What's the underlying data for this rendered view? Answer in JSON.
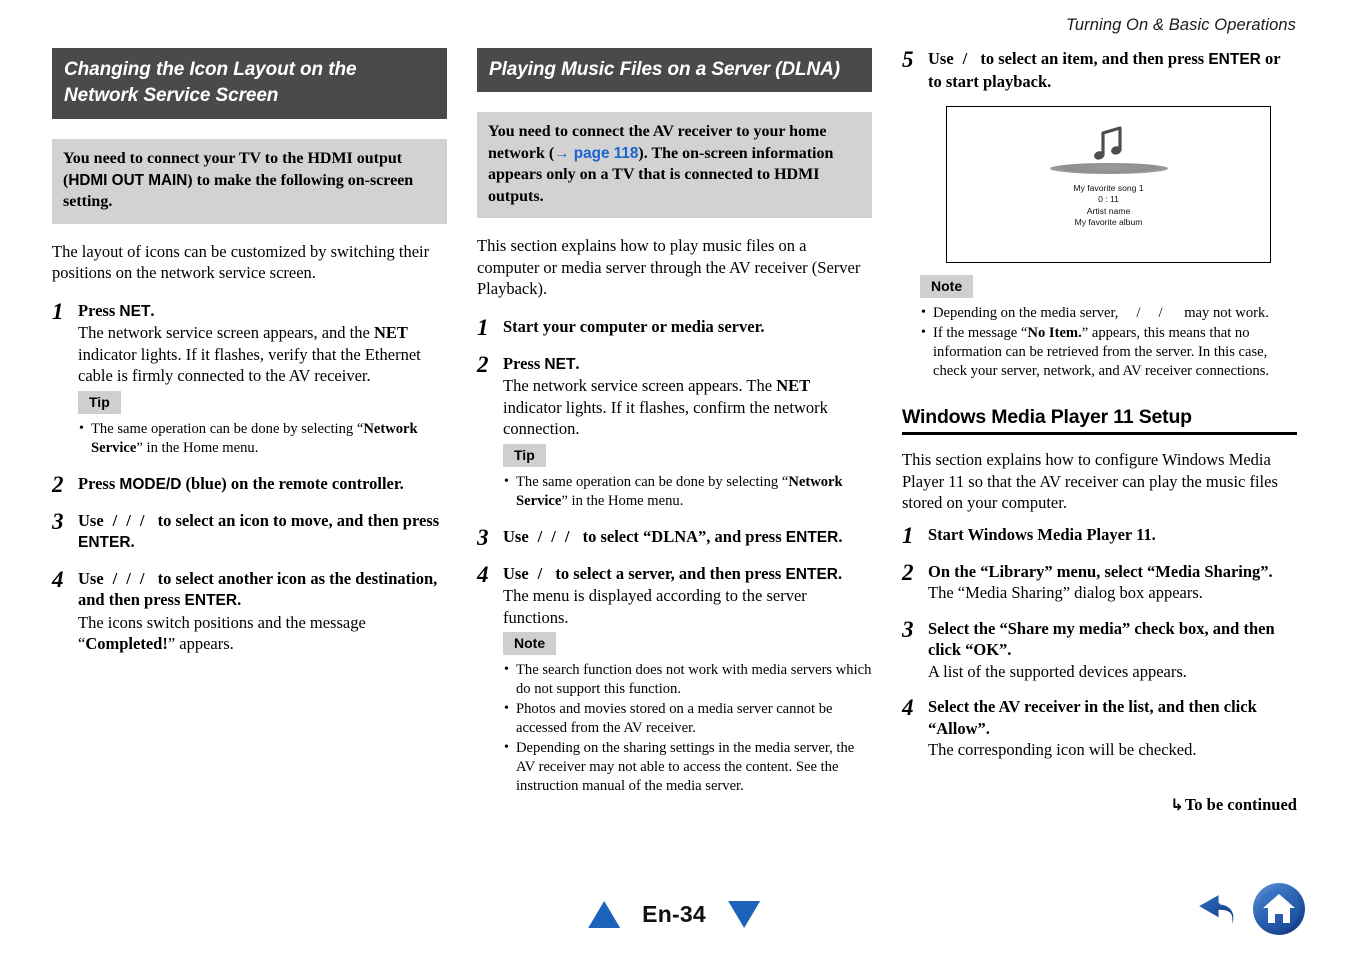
{
  "header": {
    "running_title": "Turning On & Basic Operations"
  },
  "left_column": {
    "section_title": "Changing the Icon Layout on the Network Service Screen",
    "callout": {
      "part1": "You need to connect your TV to the HDMI output (",
      "emphasis": "HDMI OUT MAIN",
      "part2": ") to make the following on-screen setting."
    },
    "intro": "The layout of icons can be customized by switching their positions on the network service screen.",
    "steps": [
      {
        "num": "1",
        "title_pre": "Press ",
        "title_key": "NET",
        "title_post": ".",
        "desc_a": "The network service screen appears, and the ",
        "desc_key": "NET",
        "desc_b": " indicator lights. If it flashes, verify that the Ethernet cable is firmly connected to the AV receiver."
      },
      {
        "num": "2",
        "title_pre": "Press ",
        "title_key": "MODE/D",
        "title_post": " (blue) on the remote controller."
      },
      {
        "num": "3",
        "title_use": "Use",
        "title_mid": "to select an icon to move, and then press ",
        "title_key": "ENTER",
        "title_post": "."
      },
      {
        "num": "4",
        "title_use": "Use",
        "title_mid": "to select another icon as the destination, and then press ",
        "title_key": "ENTER",
        "title_post": ".",
        "desc_a": "The icons switch positions and the message “",
        "desc_bold": "Completed!",
        "desc_b": "” appears."
      }
    ],
    "tip": {
      "badge": "Tip",
      "items_pre": "The same operation can be done by selecting “",
      "items_bold": "Network Service",
      "items_post": "” in the Home menu."
    }
  },
  "middle_column": {
    "section_title": "Playing Music Files on a Server (DLNA)",
    "callout": {
      "part1": "You need to connect the AV receiver to your home network (",
      "link_arrow": "→",
      "link_text": "page 118",
      "part2": "). The on-screen information appears only on a TV that is connected to HDMI outputs."
    },
    "intro": "This section explains how to play music files on a computer or media server through the AV receiver (Server Playback).",
    "steps": [
      {
        "num": "1",
        "title": "Start your computer or media server."
      },
      {
        "num": "2",
        "title_pre": "Press ",
        "title_key": "NET",
        "title_post": ".",
        "desc_a": "The network service screen appears. The ",
        "desc_key": "NET",
        "desc_b": " indicator lights. If it flashes, confirm the network connection."
      },
      {
        "num": "3",
        "title_use": "Use",
        "title_mid": "to select “DLNA”, and press ",
        "title_key": "ENTER",
        "title_post": "."
      },
      {
        "num": "4",
        "title_use": "Use",
        "title_mid": "to select a server, and then press ",
        "title_key": "ENTER",
        "title_post": ".",
        "desc": "The menu is displayed according to the server functions."
      }
    ],
    "tip": {
      "badge": "Tip",
      "items_pre": "The same operation can be done by selecting “",
      "items_bold": "Network Service",
      "items_post": "” in the Home menu."
    },
    "note": {
      "badge": "Note",
      "items": [
        "The search function does not work with media servers which do not support this function.",
        "Photos and movies stored on a media server cannot be accessed from the AV receiver.",
        "Depending on the sharing settings in the media server, the AV receiver may not able to access the content. See the instruction manual of the media server."
      ]
    }
  },
  "right_column": {
    "step5": {
      "num": "5",
      "title_use": "Use",
      "title_mid": "to select an item, and then press ",
      "title_key": "ENTER",
      "title_post": " or to start playback."
    },
    "tv_screen": {
      "icon": "music-note-icon",
      "lines": [
        "My favorite song 1",
        "0 : 11",
        "Artist name",
        "My favorite album"
      ]
    },
    "note": {
      "badge": "Note",
      "item1_pre": "Depending on the media server,",
      "item1_post": "may not work.",
      "item2_a": "If the message “",
      "item2_bold": "No Item.",
      "item2_b": "” appears, this means that no information can be retrieved from the server. In this case, check your server, network, and AV receiver connections."
    },
    "subhead": "Windows Media Player 11 Setup",
    "intro": "This section explains how to configure Windows Media Player 11 so that the AV receiver can play the music files stored on your computer.",
    "steps": [
      {
        "num": "1",
        "title": "Start Windows Media Player 11."
      },
      {
        "num": "2",
        "title": "On the “Library” menu, select “Media Sharing”.",
        "desc": "The “Media Sharing” dialog box appears."
      },
      {
        "num": "3",
        "title": "Select the “Share my media” check box, and then click “OK”.",
        "desc": "A list of the supported devices appears."
      },
      {
        "num": "4",
        "title": "Select the AV receiver in the list, and then click “Allow”.",
        "desc": "The corresponding icon will be checked."
      }
    ],
    "to_be_continued": {
      "arrow": "↳",
      "label": "To be continued"
    }
  },
  "footer": {
    "prev_icon": "triangle-up-icon",
    "page_label": "En-34",
    "next_icon": "triangle-down-icon",
    "back_icon": "back-arrow-icon",
    "home_icon": "home-icon",
    "accent_blue": "#1c63bb"
  }
}
